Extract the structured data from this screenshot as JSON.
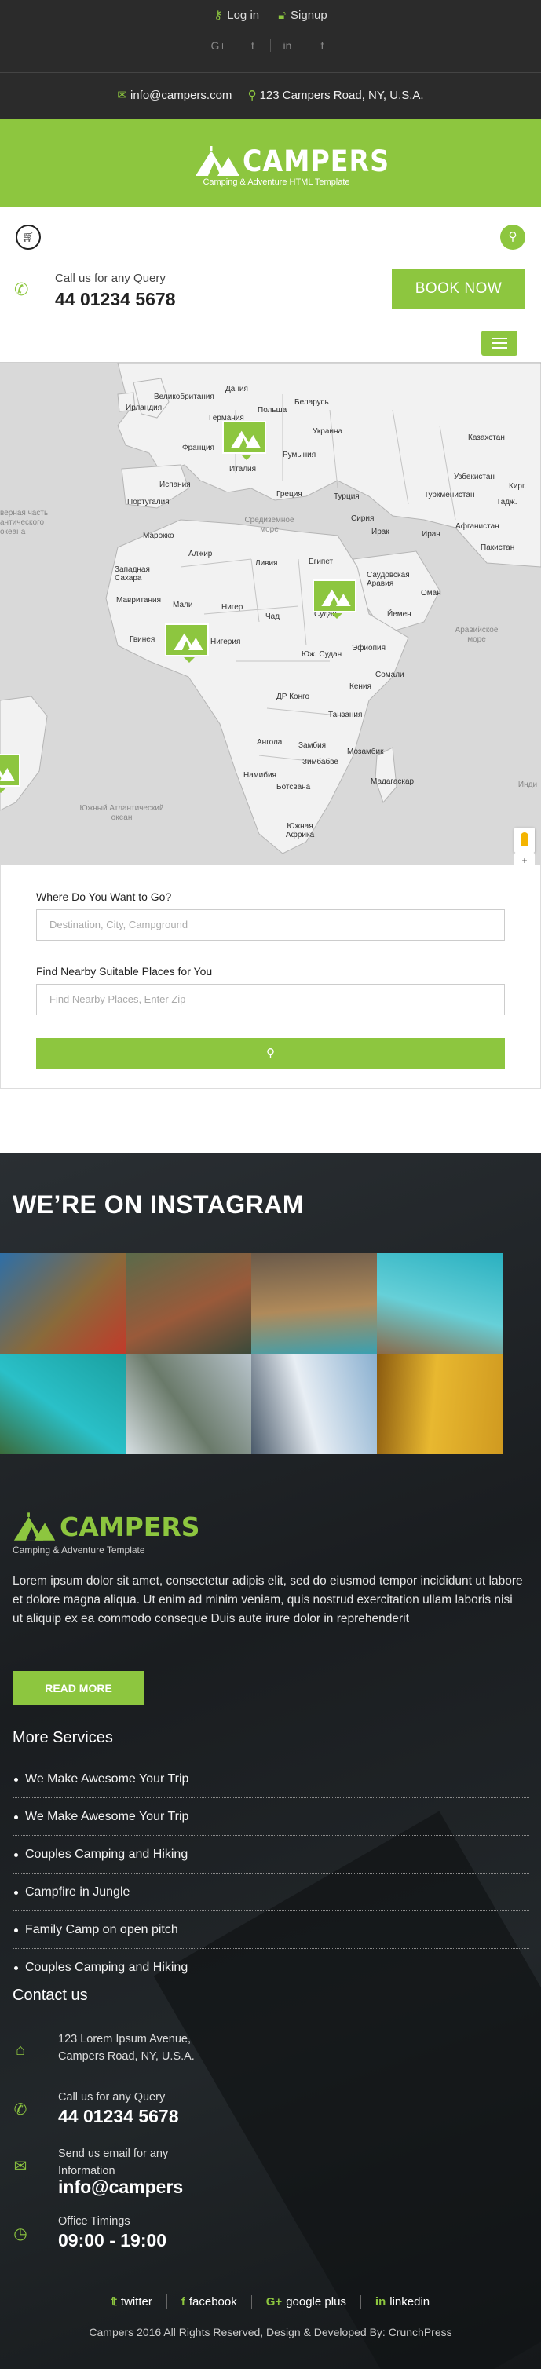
{
  "topbar": {
    "login_label": "Log in",
    "signup_label": "Signup",
    "social_icons": [
      "google-plus",
      "twitter",
      "linkedin",
      "facebook"
    ],
    "social_glyphs": [
      "G+",
      "t",
      "in",
      "f"
    ],
    "email": "info@campers.com",
    "address": "123 Campers Road, NY, U.S.A."
  },
  "brand": {
    "name": "CAMPERS",
    "tagline": "Camping & Adventure HTML Template",
    "accent_color": "#8dc63f"
  },
  "header": {
    "query_label": "Call us for any Query",
    "phone": "44 01234 5678",
    "book_label": "BOOK NOW"
  },
  "map": {
    "labels": [
      "Ирландия",
      "Великобритания",
      "Дания",
      "Германия",
      "Польша",
      "Беларусь",
      "Франция",
      "Украина",
      "Италия",
      "Румыния",
      "Казахстан",
      "Испания",
      "Португалия",
      "Греция",
      "Турция",
      "Узбекистан",
      "Туркменистан",
      "Кирг.",
      "Тадж.",
      "Сирия",
      "Ирак",
      "Иран",
      "Афганистан",
      "Пакистан",
      "Марокко",
      "Алжир",
      "Ливия",
      "Египет",
      "Саудовская Аравия",
      "Западная Сахара",
      "Мавритания",
      "Мали",
      "Нигер",
      "Чад",
      "Судан",
      "Йемен",
      "Оман",
      "Нигерия",
      "Эфиопия",
      "Юж. Судан",
      "Сомали",
      "Кения",
      "ДР Конго",
      "Танзания",
      "Ангола",
      "Замбия",
      "Мозамбик",
      "Зимбабве",
      "Намибия",
      "Ботсвана",
      "Мадагаскар",
      "Южная Африка",
      "Гвинея"
    ],
    "seas": [
      "Средиземное море",
      "Аравийское море",
      "Южный Атлантический океан",
      "Инди"
    ],
    "left_text": "верная часть антического океана"
  },
  "search": {
    "where_label": "Where Do You Want to Go?",
    "where_placeholder": "Destination, City, Campground",
    "nearby_label": "Find Nearby Suitable Places for You",
    "nearby_placeholder": "Find Nearby Places, Enter Zip"
  },
  "instagram": {
    "title": "WE’RE ON INSTAGRAM",
    "photos": [
      {
        "name": "lake-mountain-photo",
        "colors": [
          "#2e6fa7",
          "#8a6a3a",
          "#c23a2a"
        ]
      },
      {
        "name": "rock-valley-photo",
        "colors": [
          "#5a6a4a",
          "#9a5a3a",
          "#3a4a3a"
        ]
      },
      {
        "name": "resort-pool-photo",
        "colors": [
          "#6a5a4a",
          "#b08a5a",
          "#3aa0b0"
        ]
      },
      {
        "name": "overwater-bungalows-photo",
        "colors": [
          "#2ab0c0",
          "#66d0d8",
          "#8a6a4a"
        ]
      },
      {
        "name": "lagoon-boats-photo",
        "colors": [
          "#1aa0a0",
          "#2ac0c8",
          "#3a6a3a"
        ]
      },
      {
        "name": "stone-bridge-photo",
        "colors": [
          "#b8c4cc",
          "#6a7a6a",
          "#d8e0e4"
        ]
      },
      {
        "name": "ferris-wheel-photo",
        "colors": [
          "#8ab0d0",
          "#e8eef4",
          "#4a5a6a"
        ]
      },
      {
        "name": "autumn-trees-photo",
        "colors": [
          "#d09a20",
          "#e8b830",
          "#8a5a10"
        ]
      }
    ]
  },
  "footer": {
    "brand_name": "CAMPERS",
    "brand_tagline": "Camping & Adventure Template",
    "about": "Lorem ipsum dolor sit amet, consectetur adipis elit, sed do eiusmod tempor incididunt ut labore et dolore magna aliqua. Ut enim ad minim veniam, quis nostrud exercitation ullam laboris nisi ut aliquip ex ea commodo conseque Duis aute irure dolor in reprehenderit",
    "read_more": "READ MORE",
    "services_title": "More Services",
    "services": [
      "We Make Awesome Your Trip",
      "We Make Awesome Your Trip",
      "Couples Camping and Hiking",
      "Campfire in Jungle",
      "Family Camp on open pitch",
      "Couples Camping and Hiking"
    ],
    "contact_title": "Contact us",
    "address_line1": "123 Lorem Ipsum Avenue,",
    "address_line2": "Campers Road, NY, U.S.A.",
    "call_label": "Call us for any Query",
    "call_number": "44 01234 5678",
    "email_label": "Send us email for any Information",
    "email_value": "info@campers",
    "timing_label": "Office Timings",
    "timing_value": "09:00 - 19:00",
    "social": [
      "twitter",
      "facebook",
      "google plus",
      "linkedin"
    ],
    "copyright": "Campers 2016 All Rights Reserved, Design & Developed By: CrunchPress"
  }
}
